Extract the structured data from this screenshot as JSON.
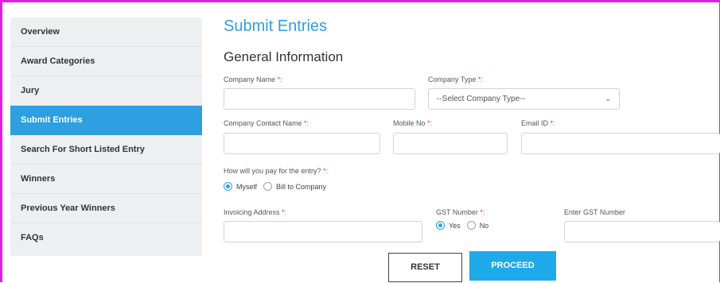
{
  "colors": {
    "accent": "#2e9fe0",
    "border_highlight": "#e020e0",
    "required": "#e23b3b",
    "proceed": "#1ea9e8"
  },
  "sidebar": {
    "items": [
      {
        "label": "Overview",
        "active": false
      },
      {
        "label": "Award Categories",
        "active": false
      },
      {
        "label": "Jury",
        "active": false
      },
      {
        "label": "Submit Entries",
        "active": true
      },
      {
        "label": "Search For Short Listed Entry",
        "active": false
      },
      {
        "label": "Winners",
        "active": false
      },
      {
        "label": "Previous Year Winners",
        "active": false
      },
      {
        "label": "FAQs",
        "active": false
      }
    ]
  },
  "main": {
    "title": "Submit Entries",
    "section_title": "General Information",
    "required_mark": "*:",
    "fields": {
      "company_name": {
        "label": "Company Name ",
        "value": ""
      },
      "company_type": {
        "label": "Company Type ",
        "selected": "--Select Company Type--"
      },
      "contact_name": {
        "label": "Company Contact Name ",
        "value": ""
      },
      "mobile": {
        "label": "Mobile No ",
        "value": ""
      },
      "email": {
        "label": "Email ID ",
        "value": ""
      },
      "pay_question": {
        "label": "How will you pay for the entry? ",
        "options": [
          "Myself",
          "Bill to Company"
        ],
        "selected": "Myself"
      },
      "invoicing_address": {
        "label": "Invoicing Address ",
        "value": ""
      },
      "gst": {
        "label": "GST Number ",
        "options": [
          "Yes",
          "No"
        ],
        "selected": "Yes"
      },
      "gst_number": {
        "label": "Enter GST Number",
        "value": ""
      }
    },
    "buttons": {
      "reset": "RESET",
      "proceed": "PROCEED"
    }
  }
}
